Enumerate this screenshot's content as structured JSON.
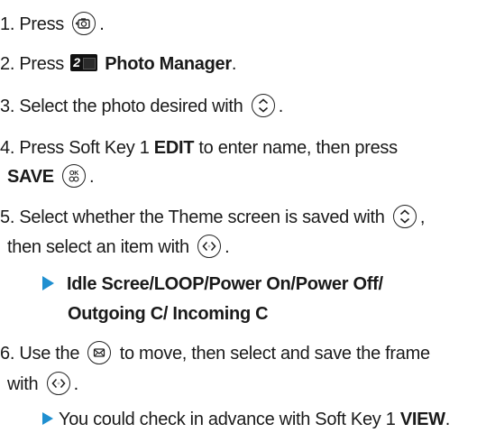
{
  "steps": {
    "s1": {
      "num": "1.",
      "pre": "Press",
      "post": "."
    },
    "s2": {
      "num": "2.",
      "pre": "Press",
      "key_label": "2",
      "bold": "Photo Manager",
      "post": "."
    },
    "s3": {
      "num": "3.",
      "pre": "Select the photo desired with",
      "post": "."
    },
    "s4": {
      "num": "4.",
      "a": "Press Soft Key 1",
      "a_bold": "EDIT",
      "a_tail": "to enter name, then press",
      "b_bold": "SAVE",
      "post": "."
    },
    "s5": {
      "num": "5.",
      "a": "Select whether the Theme screen is saved with",
      "a_tail": ",",
      "b": "then select an item with",
      "post": "."
    },
    "s5_sub": {
      "line1": "Idle Scree/LOOP/Power On/Power Off/",
      "line2": "Outgoing C/ Incoming C"
    },
    "s6": {
      "num": "6.",
      "a_pre": "Use the",
      "a_tail": "to move, then select and save the frame",
      "b": "with",
      "post": "."
    },
    "s6_sub": {
      "pre": "You could check in advance with Soft Key 1",
      "bold": "VIEW",
      "post": "."
    }
  },
  "icons": {
    "camera_key": "camera-key-icon",
    "number_key": "number-2-key-icon",
    "nav_updown": "navigation-up-down-key-icon",
    "ok_key": "ok-key-icon",
    "nav_leftright": "navigation-left-right-key-icon",
    "message_key": "message-key-icon",
    "bullet_color": "#1f8fd0"
  }
}
